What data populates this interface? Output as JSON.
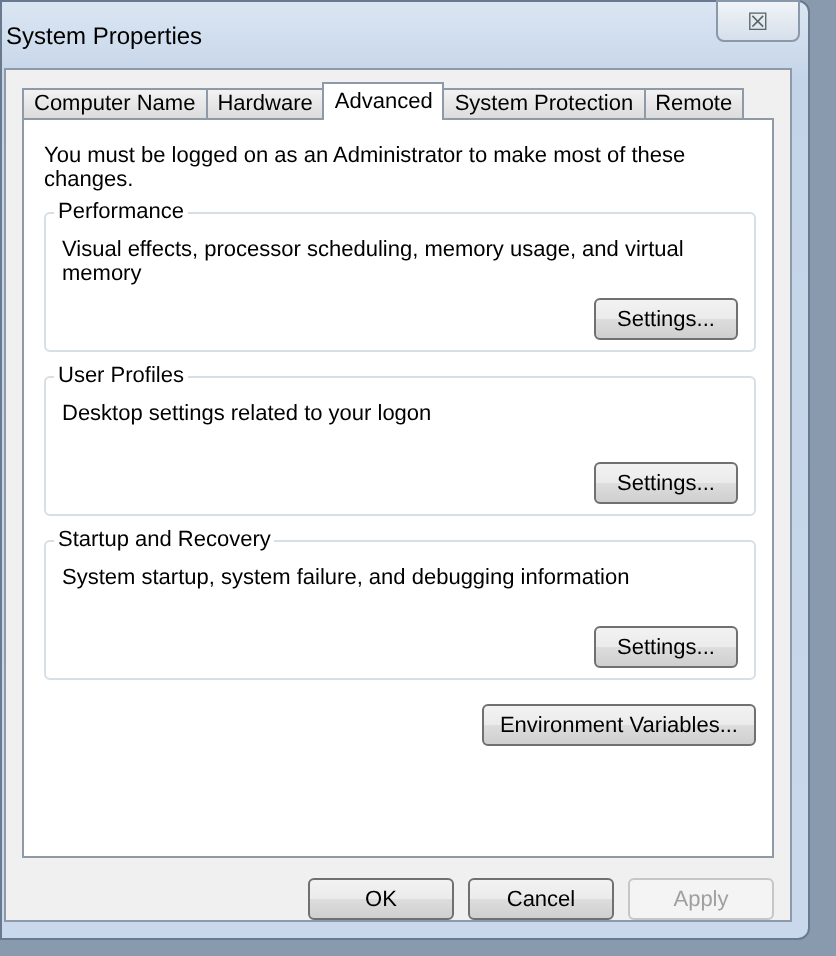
{
  "window": {
    "title": "System Properties",
    "close_icon": "☒"
  },
  "tabs": [
    {
      "label": "Computer Name",
      "selected": false
    },
    {
      "label": "Hardware",
      "selected": false
    },
    {
      "label": "Advanced",
      "selected": true
    },
    {
      "label": "System Protection",
      "selected": false
    },
    {
      "label": "Remote",
      "selected": false
    }
  ],
  "notice": "You must be logged on as an Administrator to make most of these changes.",
  "groups": [
    {
      "title": "Performance",
      "description": "Visual effects, processor scheduling, memory usage, and virtual memory",
      "button": "Settings..."
    },
    {
      "title": "User Profiles",
      "description": "Desktop settings related to your logon",
      "button": "Settings..."
    },
    {
      "title": "Startup and Recovery",
      "description": "System startup, system failure, and debugging information",
      "button": "Settings..."
    }
  ],
  "environment_button": "Environment Variables...",
  "buttons": [
    {
      "label": "OK",
      "disabled": false
    },
    {
      "label": "Cancel",
      "disabled": false
    },
    {
      "label": "Apply",
      "disabled": true
    }
  ]
}
